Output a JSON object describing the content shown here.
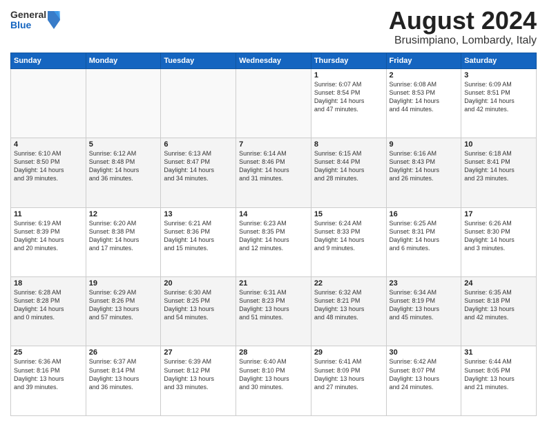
{
  "header": {
    "logo_general": "General",
    "logo_blue": "Blue",
    "title": "August 2024",
    "subtitle": "Brusimpiano, Lombardy, Italy"
  },
  "weekdays": [
    "Sunday",
    "Monday",
    "Tuesday",
    "Wednesday",
    "Thursday",
    "Friday",
    "Saturday"
  ],
  "weeks": [
    [
      {
        "day": "",
        "info": ""
      },
      {
        "day": "",
        "info": ""
      },
      {
        "day": "",
        "info": ""
      },
      {
        "day": "",
        "info": ""
      },
      {
        "day": "1",
        "info": "Sunrise: 6:07 AM\nSunset: 8:54 PM\nDaylight: 14 hours\nand 47 minutes."
      },
      {
        "day": "2",
        "info": "Sunrise: 6:08 AM\nSunset: 8:53 PM\nDaylight: 14 hours\nand 44 minutes."
      },
      {
        "day": "3",
        "info": "Sunrise: 6:09 AM\nSunset: 8:51 PM\nDaylight: 14 hours\nand 42 minutes."
      }
    ],
    [
      {
        "day": "4",
        "info": "Sunrise: 6:10 AM\nSunset: 8:50 PM\nDaylight: 14 hours\nand 39 minutes."
      },
      {
        "day": "5",
        "info": "Sunrise: 6:12 AM\nSunset: 8:48 PM\nDaylight: 14 hours\nand 36 minutes."
      },
      {
        "day": "6",
        "info": "Sunrise: 6:13 AM\nSunset: 8:47 PM\nDaylight: 14 hours\nand 34 minutes."
      },
      {
        "day": "7",
        "info": "Sunrise: 6:14 AM\nSunset: 8:46 PM\nDaylight: 14 hours\nand 31 minutes."
      },
      {
        "day": "8",
        "info": "Sunrise: 6:15 AM\nSunset: 8:44 PM\nDaylight: 14 hours\nand 28 minutes."
      },
      {
        "day": "9",
        "info": "Sunrise: 6:16 AM\nSunset: 8:43 PM\nDaylight: 14 hours\nand 26 minutes."
      },
      {
        "day": "10",
        "info": "Sunrise: 6:18 AM\nSunset: 8:41 PM\nDaylight: 14 hours\nand 23 minutes."
      }
    ],
    [
      {
        "day": "11",
        "info": "Sunrise: 6:19 AM\nSunset: 8:39 PM\nDaylight: 14 hours\nand 20 minutes."
      },
      {
        "day": "12",
        "info": "Sunrise: 6:20 AM\nSunset: 8:38 PM\nDaylight: 14 hours\nand 17 minutes."
      },
      {
        "day": "13",
        "info": "Sunrise: 6:21 AM\nSunset: 8:36 PM\nDaylight: 14 hours\nand 15 minutes."
      },
      {
        "day": "14",
        "info": "Sunrise: 6:23 AM\nSunset: 8:35 PM\nDaylight: 14 hours\nand 12 minutes."
      },
      {
        "day": "15",
        "info": "Sunrise: 6:24 AM\nSunset: 8:33 PM\nDaylight: 14 hours\nand 9 minutes."
      },
      {
        "day": "16",
        "info": "Sunrise: 6:25 AM\nSunset: 8:31 PM\nDaylight: 14 hours\nand 6 minutes."
      },
      {
        "day": "17",
        "info": "Sunrise: 6:26 AM\nSunset: 8:30 PM\nDaylight: 14 hours\nand 3 minutes."
      }
    ],
    [
      {
        "day": "18",
        "info": "Sunrise: 6:28 AM\nSunset: 8:28 PM\nDaylight: 14 hours\nand 0 minutes."
      },
      {
        "day": "19",
        "info": "Sunrise: 6:29 AM\nSunset: 8:26 PM\nDaylight: 13 hours\nand 57 minutes."
      },
      {
        "day": "20",
        "info": "Sunrise: 6:30 AM\nSunset: 8:25 PM\nDaylight: 13 hours\nand 54 minutes."
      },
      {
        "day": "21",
        "info": "Sunrise: 6:31 AM\nSunset: 8:23 PM\nDaylight: 13 hours\nand 51 minutes."
      },
      {
        "day": "22",
        "info": "Sunrise: 6:32 AM\nSunset: 8:21 PM\nDaylight: 13 hours\nand 48 minutes."
      },
      {
        "day": "23",
        "info": "Sunrise: 6:34 AM\nSunset: 8:19 PM\nDaylight: 13 hours\nand 45 minutes."
      },
      {
        "day": "24",
        "info": "Sunrise: 6:35 AM\nSunset: 8:18 PM\nDaylight: 13 hours\nand 42 minutes."
      }
    ],
    [
      {
        "day": "25",
        "info": "Sunrise: 6:36 AM\nSunset: 8:16 PM\nDaylight: 13 hours\nand 39 minutes."
      },
      {
        "day": "26",
        "info": "Sunrise: 6:37 AM\nSunset: 8:14 PM\nDaylight: 13 hours\nand 36 minutes."
      },
      {
        "day": "27",
        "info": "Sunrise: 6:39 AM\nSunset: 8:12 PM\nDaylight: 13 hours\nand 33 minutes."
      },
      {
        "day": "28",
        "info": "Sunrise: 6:40 AM\nSunset: 8:10 PM\nDaylight: 13 hours\nand 30 minutes."
      },
      {
        "day": "29",
        "info": "Sunrise: 6:41 AM\nSunset: 8:09 PM\nDaylight: 13 hours\nand 27 minutes."
      },
      {
        "day": "30",
        "info": "Sunrise: 6:42 AM\nSunset: 8:07 PM\nDaylight: 13 hours\nand 24 minutes."
      },
      {
        "day": "31",
        "info": "Sunrise: 6:44 AM\nSunset: 8:05 PM\nDaylight: 13 hours\nand 21 minutes."
      }
    ]
  ]
}
